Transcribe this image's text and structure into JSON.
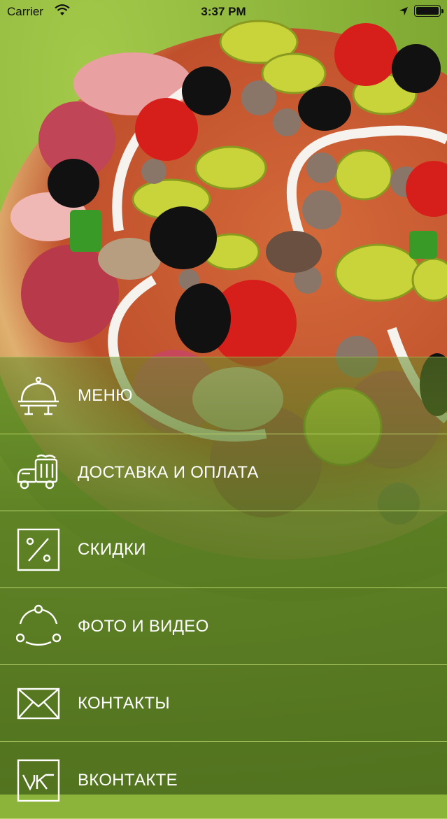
{
  "status_bar": {
    "carrier": "Carrier",
    "time": "3:37 PM",
    "wifi_icon": "wifi-icon",
    "location_icon": "location-arrow-icon",
    "battery_icon": "battery-icon"
  },
  "background": {
    "image": "pizza-photo",
    "color": "#8cb43a"
  },
  "menu": {
    "items": [
      {
        "label": "МЕНЮ",
        "icon": "serving-cloche-icon"
      },
      {
        "label": "ДОСТАВКА И ОПЛАТА",
        "icon": "delivery-truck-icon"
      },
      {
        "label": "СКИДКИ",
        "icon": "percent-icon"
      },
      {
        "label": "ФОТО И ВИДЕО",
        "icon": "share-circle-icon"
      },
      {
        "label": "КОНТАКТЫ",
        "icon": "envelope-icon"
      },
      {
        "label": "ВКОНТАКТЕ",
        "icon": "vk-icon"
      }
    ]
  },
  "colors": {
    "accent": "#b9d46a",
    "text": "#ffffff",
    "background": "#8cb43a"
  }
}
